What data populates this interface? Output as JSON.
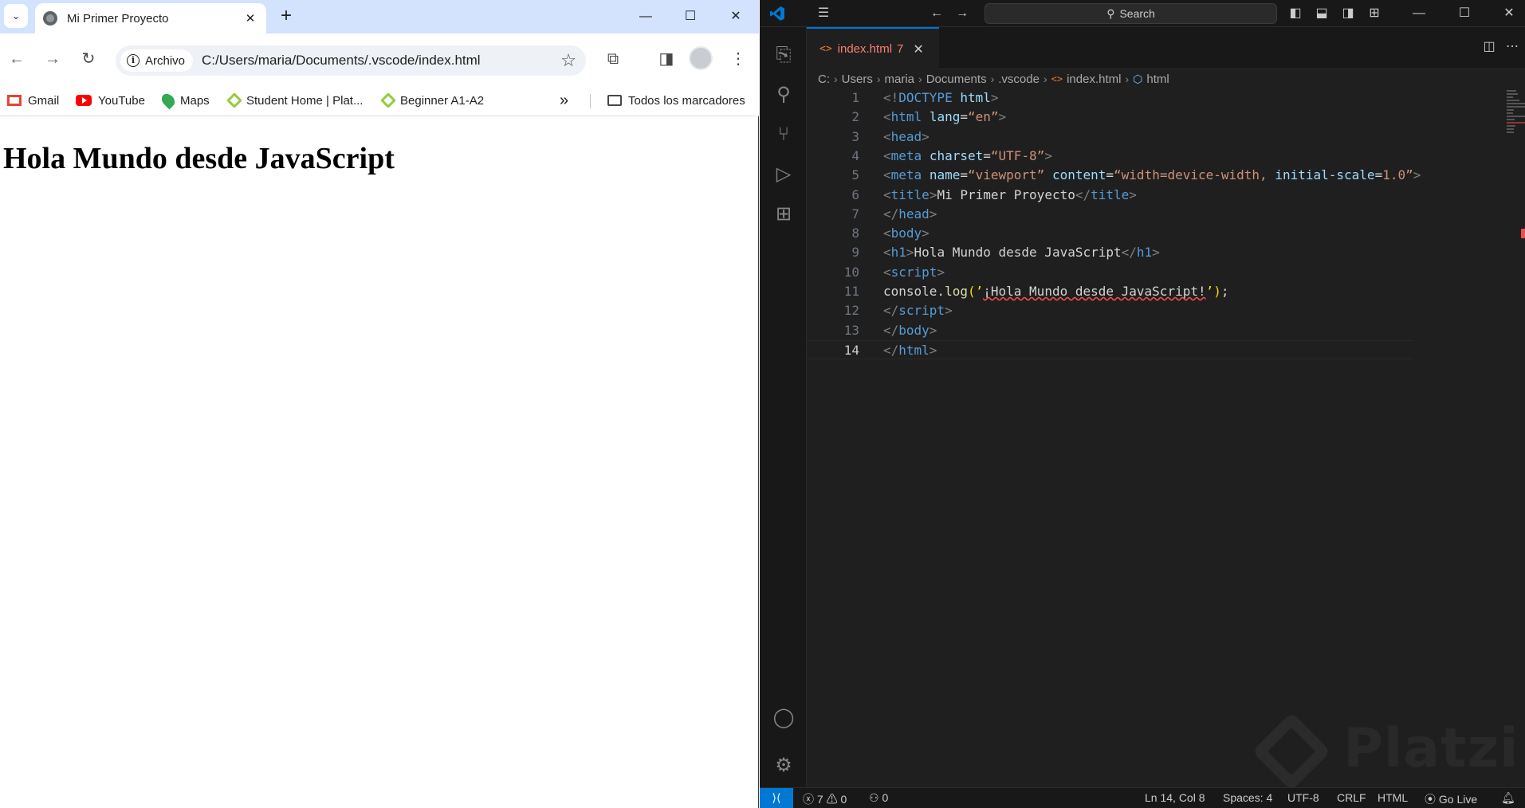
{
  "chrome": {
    "tab_title": "Mi Primer Proyecto",
    "tab_close": "✕",
    "new_tab": "+",
    "url_chip": "Archivo",
    "url": "C:/Users/maria/Documents/.vscode/index.html",
    "bookmarks": [
      {
        "label": "Gmail",
        "icon": "gmail-icon"
      },
      {
        "label": "YouTube",
        "icon": "youtube-icon"
      },
      {
        "label": "Maps",
        "icon": "maps-icon"
      },
      {
        "label": "Student Home | Plat...",
        "icon": "platzi-icon"
      },
      {
        "label": "Beginner A1-A2",
        "icon": "platzi-icon"
      }
    ],
    "bookmarks_overflow": "»",
    "all_bookmarks": "Todos los marcadores",
    "page_heading": "Hola Mundo desde JavaScript"
  },
  "vscode": {
    "search_placeholder": "Search",
    "tab": {
      "filename": "index.html",
      "problems": "7",
      "close": "✕"
    },
    "breadcrumb": [
      "C:",
      "Users",
      "maria",
      "Documents",
      ".vscode",
      "index.html",
      "html"
    ],
    "code_lines": [
      {
        "n": "1",
        "parts": [
          [
            "tg",
            "<!"
          ],
          [
            "tn",
            "DOCTYPE"
          ],
          [
            "tx",
            " "
          ],
          [
            "at",
            "html"
          ],
          [
            "tg",
            ">"
          ]
        ]
      },
      {
        "n": "2",
        "parts": [
          [
            "tg",
            "<"
          ],
          [
            "tn",
            "html"
          ],
          [
            "tx",
            " "
          ],
          [
            "at",
            "lang"
          ],
          [
            "tx",
            "="
          ],
          [
            "st",
            "“en”"
          ],
          [
            "tg",
            ">"
          ]
        ]
      },
      {
        "n": "3",
        "parts": [
          [
            "tg",
            "<"
          ],
          [
            "tn",
            "head"
          ],
          [
            "tg",
            ">"
          ]
        ]
      },
      {
        "n": "4",
        "parts": [
          [
            "tg",
            "<"
          ],
          [
            "tn",
            "meta"
          ],
          [
            "tx",
            " "
          ],
          [
            "at",
            "charset"
          ],
          [
            "tx",
            "="
          ],
          [
            "st",
            "“UTF-8”"
          ],
          [
            "tg",
            ">"
          ]
        ]
      },
      {
        "n": "5",
        "parts": [
          [
            "tg",
            "<"
          ],
          [
            "tn",
            "meta"
          ],
          [
            "tx",
            " "
          ],
          [
            "at",
            "name"
          ],
          [
            "tx",
            "="
          ],
          [
            "st",
            "“viewport”"
          ],
          [
            "tx",
            " "
          ],
          [
            "at",
            "content"
          ],
          [
            "tx",
            "="
          ],
          [
            "st",
            "“width=device-width, "
          ],
          [
            "at",
            "initial-scale"
          ],
          [
            "tx",
            "="
          ],
          [
            "st",
            "1.0”"
          ],
          [
            "tg",
            ">"
          ]
        ]
      },
      {
        "n": "6",
        "parts": [
          [
            "tg",
            "<"
          ],
          [
            "tn",
            "title"
          ],
          [
            "tg",
            ">"
          ],
          [
            "tx",
            "Mi Primer Proyecto"
          ],
          [
            "tg",
            "</"
          ],
          [
            "tn",
            "title"
          ],
          [
            "tg",
            ">"
          ]
        ]
      },
      {
        "n": "7",
        "parts": [
          [
            "tg",
            "</"
          ],
          [
            "tn",
            "head"
          ],
          [
            "tg",
            ">"
          ]
        ]
      },
      {
        "n": "8",
        "parts": [
          [
            "tg",
            "<"
          ],
          [
            "tn",
            "body"
          ],
          [
            "tg",
            ">"
          ]
        ]
      },
      {
        "n": "9",
        "parts": [
          [
            "tg",
            "<"
          ],
          [
            "tn",
            "h1"
          ],
          [
            "tg",
            ">"
          ],
          [
            "tx",
            "Hola Mundo desde JavaScript"
          ],
          [
            "tg",
            "</"
          ],
          [
            "tn",
            "h1"
          ],
          [
            "tg",
            ">"
          ]
        ]
      },
      {
        "n": "10",
        "parts": [
          [
            "tg",
            "<"
          ],
          [
            "tn",
            "script"
          ],
          [
            "tg",
            ">"
          ]
        ]
      },
      {
        "n": "11",
        "parts": [
          [
            "tx",
            "console."
          ],
          [
            "fn",
            "log"
          ],
          [
            "pn",
            "("
          ],
          [
            "pn",
            "’"
          ],
          [
            "tx squiggle",
            "¡Hola Mundo desde JavaScript!"
          ],
          [
            "pn",
            "’"
          ],
          [
            "pn",
            ")"
          ],
          [
            "tx",
            ";"
          ]
        ]
      },
      {
        "n": "12",
        "parts": [
          [
            "tg",
            "</"
          ],
          [
            "tn",
            "script"
          ],
          [
            "tg",
            ">"
          ]
        ]
      },
      {
        "n": "13",
        "parts": [
          [
            "tg",
            "</"
          ],
          [
            "tn",
            "body"
          ],
          [
            "tg",
            ">"
          ]
        ]
      },
      {
        "n": "14",
        "parts": [
          [
            "tg",
            "</"
          ],
          [
            "tn",
            "html"
          ],
          [
            "tg",
            ">"
          ]
        ]
      }
    ],
    "current_line": "14",
    "watermark": "Platzi",
    "status": {
      "errors": "7",
      "warnings": "0",
      "ports": "0",
      "position": "Ln 14, Col 8",
      "spaces": "Spaces: 4",
      "encoding": "UTF-8",
      "eol": "CRLF",
      "language": "HTML",
      "go_live": "Go Live"
    }
  }
}
